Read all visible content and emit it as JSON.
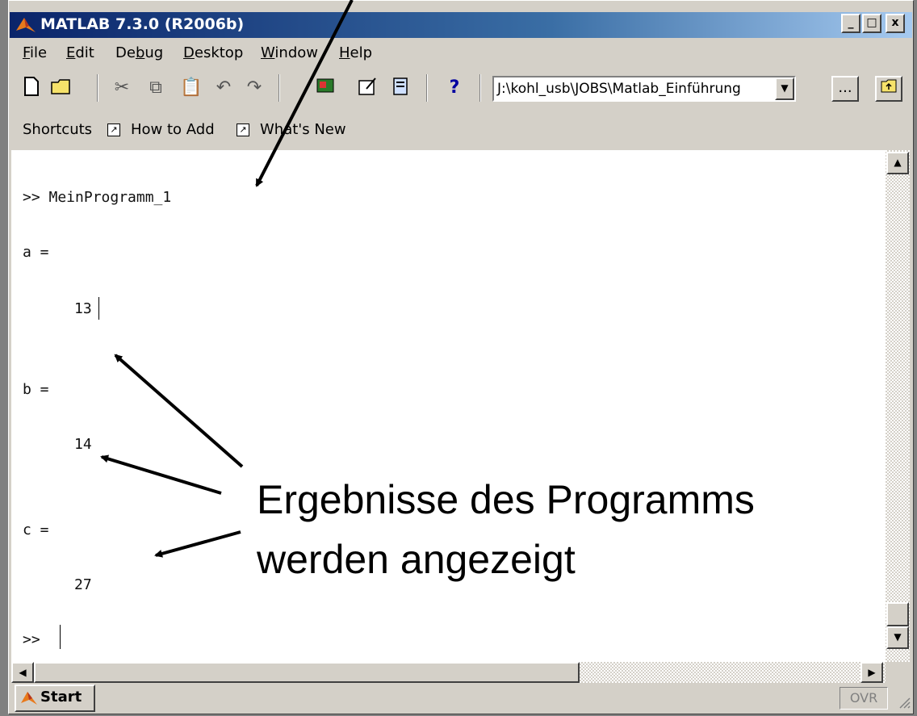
{
  "window": {
    "title": "MATLAB  7.3.0 (R2006b)",
    "min_label": "_",
    "max_label": "□",
    "close_label": "x"
  },
  "menu": [
    {
      "label": "File",
      "u": "F"
    },
    {
      "label": "Edit",
      "u": "E"
    },
    {
      "label": "Debug",
      "u": "b"
    },
    {
      "label": "Desktop",
      "u": "D"
    },
    {
      "label": "Window",
      "u": "W"
    },
    {
      "label": "Help",
      "u": "H"
    }
  ],
  "toolbar": {
    "current_dir": "J:\\kohl_usb\\JOBS\\Matlab_Einführung",
    "browse_label": "...",
    "help_icon_glyph": "?"
  },
  "shortcuts": {
    "label": "Shortcuts",
    "items": [
      "How to Add",
      "What's New"
    ]
  },
  "console": {
    "lines": [
      ">> MeinProgramm_1",
      "a =",
      "13",
      "b =",
      "14",
      "c =",
      "27",
      ">>"
    ]
  },
  "annotation": {
    "line1": "Ergebnisse des Programms",
    "line2": "werden angezeigt"
  },
  "statusbar": {
    "start_label": "Start",
    "ovr_label": "OVR"
  }
}
